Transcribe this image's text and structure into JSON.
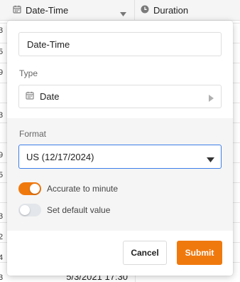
{
  "grid": {
    "columns": [
      {
        "name": "Date-Time",
        "icon": "calendar-icon"
      },
      {
        "name": "Duration",
        "icon": "clock-icon"
      }
    ],
    "row_fragments": [
      "3",
      "5",
      "9",
      "3",
      "9",
      "5",
      "3",
      "2",
      "4",
      "3"
    ],
    "visible_cell_text": "5/3/2021 17:30"
  },
  "dialog": {
    "column_name_value": "Date-Time",
    "type_label": "Type",
    "type_value": "Date",
    "type_icon": "calendar-icon",
    "format_label": "Format",
    "format_value": "US (12/17/2024)",
    "toggles": [
      {
        "label": "Accurate to minute",
        "on": true
      },
      {
        "label": "Set default value",
        "on": false
      }
    ],
    "cancel_label": "Cancel",
    "submit_label": "Submit"
  },
  "colors": {
    "accent": "#f0790e",
    "focus": "#3d7ee8",
    "section_bg": "#f5f5f5"
  }
}
